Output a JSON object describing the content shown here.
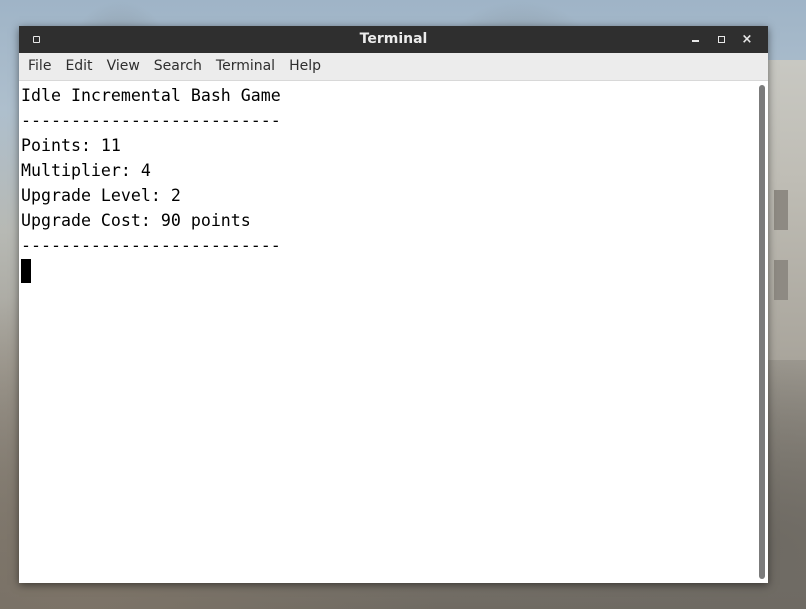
{
  "window": {
    "title": "Terminal",
    "minimize_glyph": "_",
    "maximize_glyph": "□",
    "close_glyph": "×"
  },
  "menubar": {
    "items": [
      "File",
      "Edit",
      "View",
      "Search",
      "Terminal",
      "Help"
    ]
  },
  "terminal": {
    "lines": [
      "Idle Incremental Bash Game",
      "--------------------------",
      "Points: 11",
      "Multiplier: 4",
      "Upgrade Level: 2",
      "Upgrade Cost: 90 points",
      "--------------------------"
    ]
  }
}
